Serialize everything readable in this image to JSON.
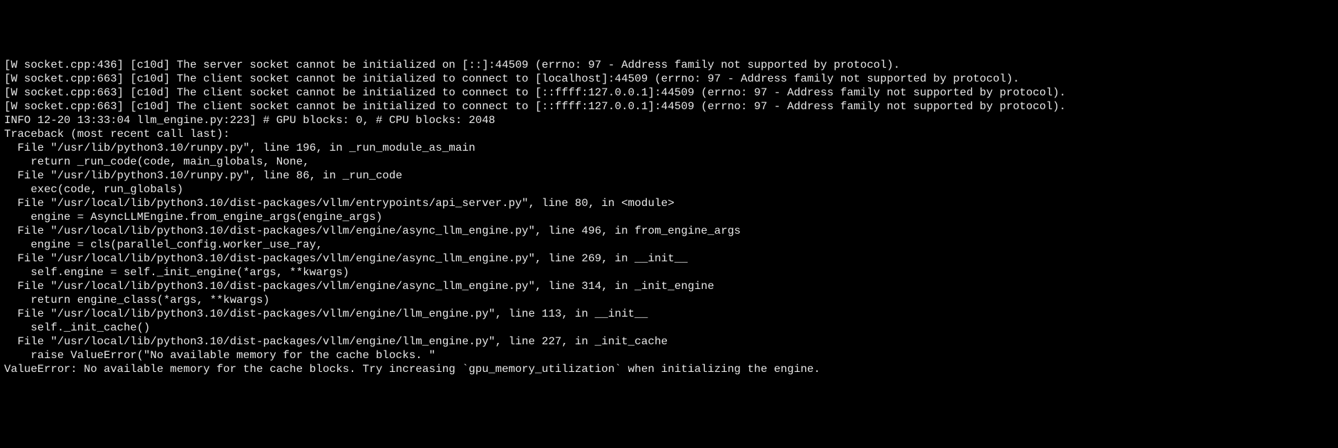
{
  "terminal": {
    "lines": [
      "[W socket.cpp:436] [c10d] The server socket cannot be initialized on [::]:44509 (errno: 97 - Address family not supported by protocol).",
      "[W socket.cpp:663] [c10d] The client socket cannot be initialized to connect to [localhost]:44509 (errno: 97 - Address family not supported by protocol).",
      "[W socket.cpp:663] [c10d] The client socket cannot be initialized to connect to [::ffff:127.0.0.1]:44509 (errno: 97 - Address family not supported by protocol).",
      "[W socket.cpp:663] [c10d] The client socket cannot be initialized to connect to [::ffff:127.0.0.1]:44509 (errno: 97 - Address family not supported by protocol).",
      "INFO 12-20 13:33:04 llm_engine.py:223] # GPU blocks: 0, # CPU blocks: 2048",
      "Traceback (most recent call last):",
      "  File \"/usr/lib/python3.10/runpy.py\", line 196, in _run_module_as_main",
      "    return _run_code(code, main_globals, None,",
      "  File \"/usr/lib/python3.10/runpy.py\", line 86, in _run_code",
      "    exec(code, run_globals)",
      "  File \"/usr/local/lib/python3.10/dist-packages/vllm/entrypoints/api_server.py\", line 80, in <module>",
      "    engine = AsyncLLMEngine.from_engine_args(engine_args)",
      "  File \"/usr/local/lib/python3.10/dist-packages/vllm/engine/async_llm_engine.py\", line 496, in from_engine_args",
      "    engine = cls(parallel_config.worker_use_ray,",
      "  File \"/usr/local/lib/python3.10/dist-packages/vllm/engine/async_llm_engine.py\", line 269, in __init__",
      "    self.engine = self._init_engine(*args, **kwargs)",
      "  File \"/usr/local/lib/python3.10/dist-packages/vllm/engine/async_llm_engine.py\", line 314, in _init_engine",
      "    return engine_class(*args, **kwargs)",
      "  File \"/usr/local/lib/python3.10/dist-packages/vllm/engine/llm_engine.py\", line 113, in __init__",
      "    self._init_cache()",
      "  File \"/usr/local/lib/python3.10/dist-packages/vllm/engine/llm_engine.py\", line 227, in _init_cache",
      "    raise ValueError(\"No available memory for the cache blocks. \"",
      "ValueError: No available memory for the cache blocks. Try increasing `gpu_memory_utilization` when initializing the engine."
    ]
  }
}
